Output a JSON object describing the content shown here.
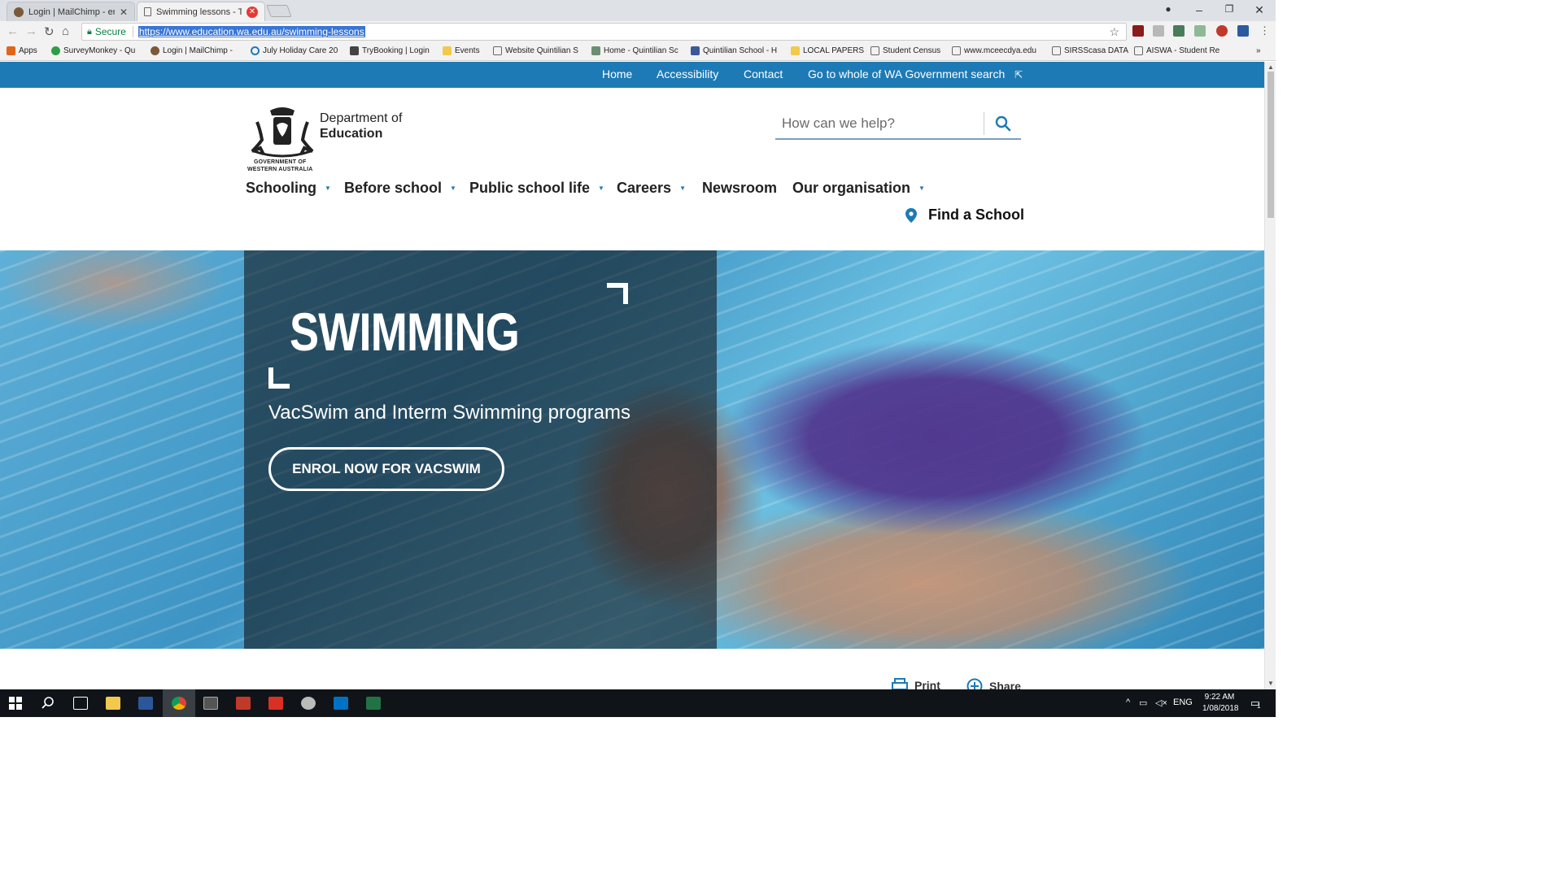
{
  "browser": {
    "tabs": [
      {
        "title": "Login | MailChimp - emai",
        "active": false
      },
      {
        "title": "Swimming lessons - The",
        "active": true
      }
    ],
    "secure_label": "Secure",
    "url": "https://www.education.wa.edu.au/swimming-lessons",
    "bookmarks": [
      {
        "label": "Apps",
        "icon": "apps-icon"
      },
      {
        "label": "SurveyMonkey - Qu",
        "icon": "surveymonkey-icon"
      },
      {
        "label": "Login | MailChimp -",
        "icon": "mailchimp-icon"
      },
      {
        "label": "July Holiday Care 20",
        "icon": "holiday-care-icon"
      },
      {
        "label": "TryBooking | Login",
        "icon": "trybooking-icon"
      },
      {
        "label": "Events",
        "icon": "folder-icon"
      },
      {
        "label": "Website Quintilian S",
        "icon": "page-icon"
      },
      {
        "label": "Home - Quintilian Sc",
        "icon": "quintilian-icon"
      },
      {
        "label": "Quintilian School - H",
        "icon": "facebook-icon"
      },
      {
        "label": "LOCAL PAPERS",
        "icon": "folder-icon"
      },
      {
        "label": "Student Census",
        "icon": "page-icon"
      },
      {
        "label": "www.mceecdya.edu",
        "icon": "page-icon"
      },
      {
        "label": "SIRSScasa DATA",
        "icon": "page-icon"
      },
      {
        "label": "AISWA - Student Re",
        "icon": "page-icon"
      }
    ],
    "overflow_label": "»"
  },
  "utility_nav": {
    "home": "Home",
    "accessibility": "Accessibility",
    "contact": "Contact",
    "wa_gov": "Go to whole of WA Government search"
  },
  "header": {
    "crest_line1": "GOVERNMENT OF",
    "crest_line2": "WESTERN AUSTRALIA",
    "dept_line1": "Department of",
    "dept_line2": "Education",
    "search_placeholder": "How can we help?"
  },
  "main_nav": {
    "items": [
      {
        "label": "Schooling",
        "has_dropdown": true
      },
      {
        "label": "Before school",
        "has_dropdown": true
      },
      {
        "label": "Public school life",
        "has_dropdown": true
      },
      {
        "label": "Careers",
        "has_dropdown": true
      },
      {
        "label": "Newsroom",
        "has_dropdown": false
      },
      {
        "label": "Our organisation",
        "has_dropdown": true
      }
    ],
    "find_school": "Find a School",
    "dropdown_glyph": "▼"
  },
  "hero": {
    "title": "SWIMMING",
    "subtitle": "VacSwim and Interm Swimming programs",
    "cta": "ENROL NOW FOR VACSWIM"
  },
  "page_tools": {
    "print": "Print",
    "share": "Share"
  },
  "taskbar": {
    "language": "ENG",
    "time": "9:22 AM",
    "date": "1/08/2018",
    "notification_count": "1"
  },
  "colors": {
    "brand_blue": "#1d7ab5",
    "accent_icon": "#1d7ab5",
    "text_dark": "#222222"
  }
}
